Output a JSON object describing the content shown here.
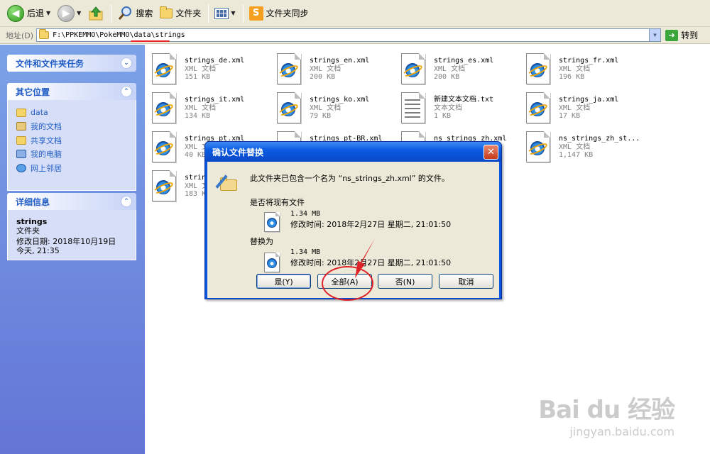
{
  "toolbar": {
    "back_label": "后退",
    "search_label": "搜索",
    "folders_label": "文件夹",
    "sync_label": "文件夹同步"
  },
  "address": {
    "label": "地址(D)",
    "path": "F:\\PPKEMMO\\PokeMMO\\data\\strings",
    "go_label": "转到"
  },
  "tasks_panel": {
    "title": "文件和文件夹任务"
  },
  "other_places": {
    "title": "其它位置",
    "items": [
      "data",
      "我的文档",
      "共享文档",
      "我的电脑",
      "网上邻居"
    ]
  },
  "details": {
    "title": "详细信息",
    "name": "strings",
    "type": "文件夹",
    "modified_label": "修改日期: 2018年10月19日",
    "modified_time": "今天, 21:35"
  },
  "files": [
    {
      "name": "strings_de.xml",
      "type": "XML 文档",
      "size": "151 KB",
      "icon": "ie-xml"
    },
    {
      "name": "strings_en.xml",
      "type": "XML 文档",
      "size": "200 KB",
      "icon": "ie-xml"
    },
    {
      "name": "strings_es.xml",
      "type": "XML 文档",
      "size": "200 KB",
      "icon": "ie-xml"
    },
    {
      "name": "strings_fr.xml",
      "type": "XML 文档",
      "size": "196 KB",
      "icon": "ie-xml"
    },
    {
      "name": "strings_it.xml",
      "type": "XML 文档",
      "size": "134 KB",
      "icon": "ie-xml"
    },
    {
      "name": "strings_ko.xml",
      "type": "XML 文档",
      "size": "79 KB",
      "icon": "ie-xml"
    },
    {
      "name": "新建文本文档.txt",
      "type": "文本文档",
      "size": "1 KB",
      "icon": "text"
    },
    {
      "name": "strings_ja.xml",
      "type": "XML 文档",
      "size": "17 KB",
      "icon": "ie-xml"
    },
    {
      "name": "strings_pt.xml",
      "type": "XML 文档",
      "size": "40 KB",
      "icon": "ie-xml"
    },
    {
      "name": "strings_pt-BR.xml",
      "type": "",
      "size": "",
      "icon": "ie-xml"
    },
    {
      "name": "ns_strings_zh.xml",
      "type": "",
      "size": "",
      "icon": "ie-xml"
    },
    {
      "name": "ns_strings_zh_st...",
      "type": "XML 文档",
      "size": "1,147 KB",
      "icon": "ie-xml"
    },
    {
      "name": "strin",
      "type": "XML 文",
      "size": "183 K",
      "icon": "ie-xml"
    }
  ],
  "dialog": {
    "title": "确认文件替换",
    "message": "此文件夹已包含一个名为 “ns_strings_zh.xml” 的文件。",
    "question": "是否将现有文件",
    "existing_size": "1.34 MB",
    "existing_modified": "修改时间: 2018年2月27日 星期二, 21:01:50",
    "replace_with": "替换为",
    "new_size": "1.34 MB",
    "new_modified": "修改时间: 2018年2月27日 星期二, 21:01:50",
    "buttons": {
      "yes": "是(Y)",
      "all": "全部(A)",
      "no": "否(N)",
      "cancel": "取消"
    }
  },
  "watermark": {
    "brand": "Bai du 经验",
    "url": "jingyan.baidu.com"
  },
  "colors": {
    "annotation": "#e02328",
    "taskpane_top": "#7ba2e7",
    "taskpane_bottom": "#6375d6",
    "link": "#215dc6",
    "dialog_title": "#0a55e0"
  }
}
